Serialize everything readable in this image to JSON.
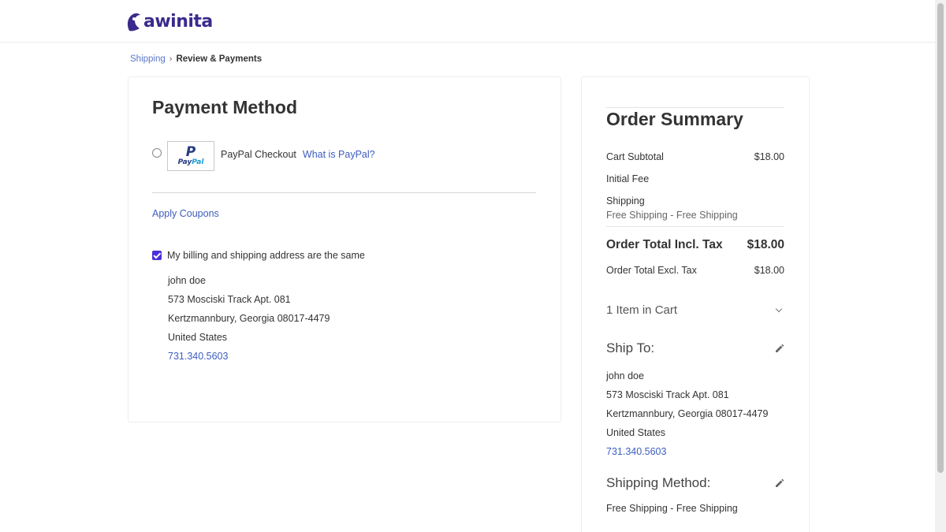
{
  "header": {
    "logo_text": "awinita"
  },
  "breadcrumb": {
    "step1": "Shipping",
    "separator": "›",
    "step2": "Review & Payments"
  },
  "payment": {
    "title": "Payment Method",
    "option_label": "PayPal Checkout",
    "option_link": "What is PayPal?",
    "logo_pay": "Pay",
    "logo_pal": "Pal",
    "apply_coupons": "Apply Coupons",
    "same_address_label": "My billing and shipping address are the same",
    "same_address_checked": true,
    "address": {
      "name": "john doe",
      "street": "573 Mosciski Track Apt. 081",
      "city_line": "Kertzmannbury, Georgia 08017-4479",
      "country": "United States",
      "phone": "731.340.5603"
    }
  },
  "summary": {
    "title": "Order Summary",
    "cart_subtotal_label": "Cart Subtotal",
    "cart_subtotal_value": "$18.00",
    "initial_fee_label": "Initial Fee",
    "shipping_label": "Shipping",
    "shipping_value": "Free Shipping - Free Shipping",
    "total_incl_label": "Order Total Incl. Tax",
    "total_incl_value": "$18.00",
    "total_excl_label": "Order Total Excl. Tax",
    "total_excl_value": "$18.00",
    "items_in_cart": "1 Item in Cart",
    "ship_to_title": "Ship To:",
    "ship_to": {
      "name": "john doe",
      "street": "573 Mosciski Track Apt. 081",
      "city_line": "Kertzmannbury, Georgia 08017-4479",
      "country": "United States",
      "phone": "731.340.5603"
    },
    "shipping_method_title": "Shipping Method:",
    "shipping_method_value": "Free Shipping - Free Shipping"
  },
  "colors": {
    "brand": "#3b2a8c",
    "link": "#3d5dbe",
    "checkbox": "#4b2fd9"
  }
}
